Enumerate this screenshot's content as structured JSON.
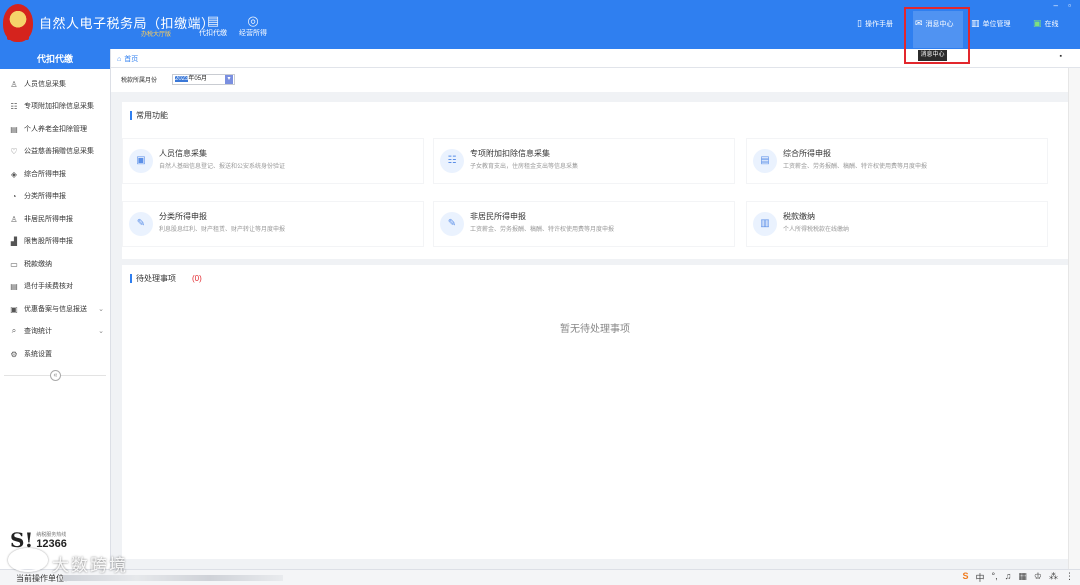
{
  "header": {
    "title": "自然人电子税务局（扣缴端）",
    "hall_link": "办税大厅版",
    "nav": [
      {
        "label": "代扣代缴",
        "icon": "briefcase-icon"
      },
      {
        "label": "经营所得",
        "icon": "coins-icon"
      }
    ],
    "tools": {
      "manual": "操作手册",
      "message": "消息中心",
      "unit": "单位管理",
      "online": "在线"
    },
    "tooltip": "消息中心"
  },
  "sidebar": {
    "heading": "代扣代缴",
    "items": [
      {
        "label": "人员信息采集",
        "icon": "person-icon"
      },
      {
        "label": "专项附加扣除信息采集",
        "icon": "list-icon"
      },
      {
        "label": "个人养老金扣除管理",
        "icon": "document-icon"
      },
      {
        "label": "公益慈善捐赠信息采集",
        "icon": "charity-icon"
      },
      {
        "label": "综合所得申报",
        "icon": "layers-icon"
      },
      {
        "label": "分类所得申报",
        "icon": "pie-icon"
      },
      {
        "label": "非居民所得申报",
        "icon": "person-icon"
      },
      {
        "label": "限售股所得申报",
        "icon": "chart-icon"
      },
      {
        "label": "税款缴纳",
        "icon": "card-icon"
      },
      {
        "label": "退付手续费核对",
        "icon": "document-icon"
      },
      {
        "label": "优惠备案与信息报送",
        "icon": "folder-icon"
      },
      {
        "label": "查询统计",
        "icon": "search-icon"
      },
      {
        "label": "系统设置",
        "icon": "gear-icon"
      }
    ],
    "hotline_label": "纳税服务热线",
    "hotline_number": "12366"
  },
  "main": {
    "breadcrumb": "首页",
    "month_label": "税款所属月份",
    "month_year_selected": "2023",
    "month_rest": "年05月",
    "common": {
      "title": "常用功能",
      "cards": [
        {
          "title": "人员信息采集",
          "desc": "自然人基础信息登记、报送和公安系统身份验证",
          "icon": "id-card-icon"
        },
        {
          "title": "专项附加扣除信息采集",
          "desc": "子女教育支出，住房租金支出等信息采集",
          "icon": "form-icon"
        },
        {
          "title": "综合所得申报",
          "desc": "工资薪金、劳务报酬、稿酬、特许权使用费等月度申报",
          "icon": "report-icon"
        },
        {
          "title": "分类所得申报",
          "desc": "利息股息红利、财产租赁、财产转让等月度申报",
          "icon": "edit-icon"
        },
        {
          "title": "非居民所得申报",
          "desc": "工资薪金、劳务报酬、稿酬、特许权使用费等月度申报",
          "icon": "edit-icon"
        },
        {
          "title": "税款缴纳",
          "desc": "个人所得税税款在线缴纳",
          "icon": "payment-icon"
        }
      ]
    },
    "pending": {
      "title": "待处理事项",
      "count": "(0)",
      "empty": "暂无待处理事项"
    }
  },
  "status": {
    "label": "当前操作单位："
  },
  "watermark": "大数跨境",
  "colors": {
    "primary": "#2f7ff0",
    "highlight": "#e2272d"
  }
}
